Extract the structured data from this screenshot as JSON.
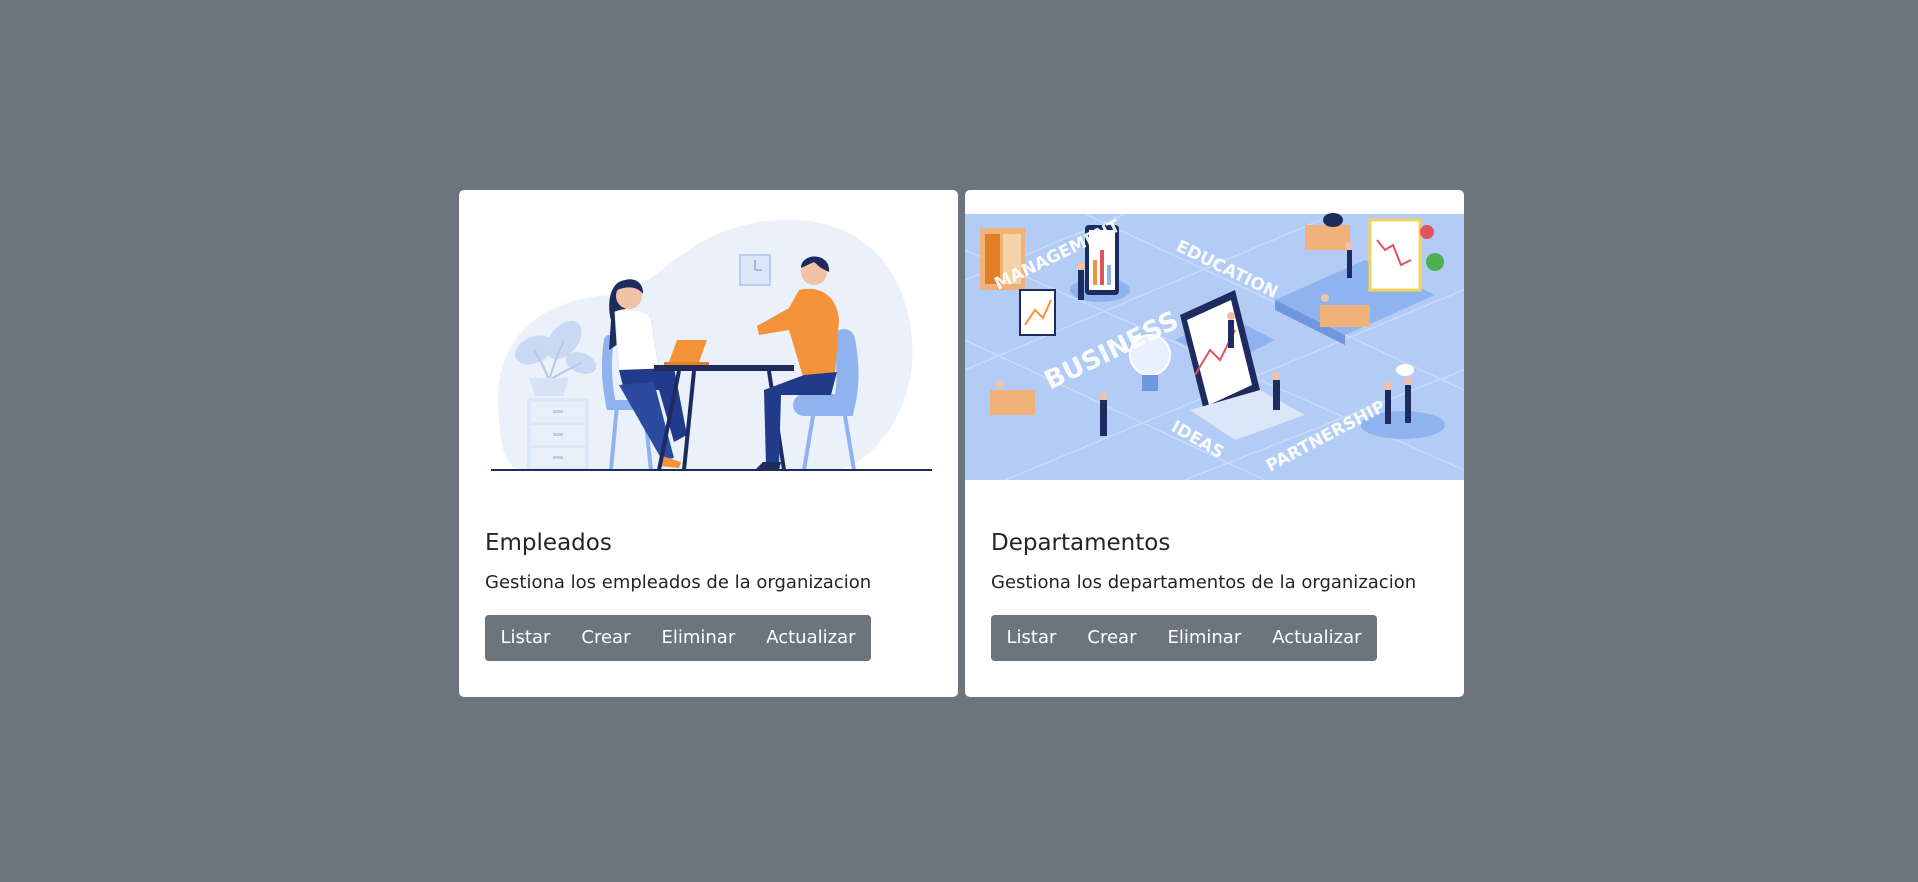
{
  "cards": [
    {
      "title": "Empleados",
      "description": "Gestiona los empleados de la organizacion",
      "image_icon": "people-meeting-illustration",
      "buttons": [
        "Listar",
        "Crear",
        "Eliminar",
        "Actualizar"
      ]
    },
    {
      "title": "Departamentos",
      "description": "Gestiona los departamentos de la organizacion",
      "image_icon": "business-isometric-illustration",
      "image_labels": [
        "MANAGEMENT",
        "EDUCATION",
        "BUSINESS",
        "IDEAS",
        "PARTNERSHIP"
      ],
      "buttons": [
        "Listar",
        "Crear",
        "Eliminar",
        "Actualizar"
      ]
    }
  ],
  "colors": {
    "background": "#6c757d",
    "card": "#ffffff",
    "button": "#6c757d",
    "illustration_blue": "#8fb3ee",
    "illustration_dark": "#1d2b5e",
    "illustration_orange": "#f5933a"
  }
}
